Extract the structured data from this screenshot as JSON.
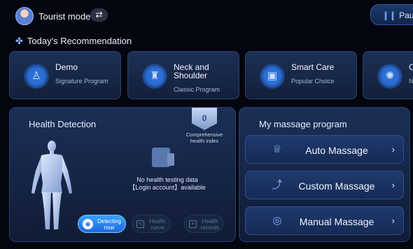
{
  "header": {
    "mode_label": "Tourist mode",
    "switch_glyph": "⇄",
    "pause_label": "Pause"
  },
  "recommendation": {
    "title": "Today's Recommendation",
    "cards": [
      {
        "title": "Demo",
        "subtitle": "Signature Program",
        "icon": "person-sitting-icon"
      },
      {
        "title": "Neck and Shoulder",
        "subtitle": "Classic Program",
        "icon": "shoulder-icon"
      },
      {
        "title": "Smart Care",
        "subtitle": "Popular Choice",
        "icon": "chip-icon"
      },
      {
        "title": "C",
        "subtitle": "N",
        "icon": "massage-icon"
      }
    ]
  },
  "health": {
    "title": "Health Detection",
    "index_value": "0",
    "index_label": "Comprehensive health index",
    "nodata_line1": "No health testing data",
    "nodata_line2": "【Login account】available",
    "chips": [
      {
        "label": "Detecting now",
        "active": true
      },
      {
        "label": "Health curve",
        "active": false
      },
      {
        "label": "Health records",
        "active": false
      }
    ]
  },
  "massage": {
    "title": "My massage program",
    "buttons": [
      {
        "label": "Auto Massage",
        "icon": "crown-icon"
      },
      {
        "label": "Custom Massage",
        "icon": "curve-adjust-icon"
      },
      {
        "label": "Manual Massage",
        "icon": "target-icon"
      }
    ]
  },
  "colors": {
    "accent": "#3aa2ff",
    "background": "#03060f",
    "panel": "#1b2f56"
  }
}
